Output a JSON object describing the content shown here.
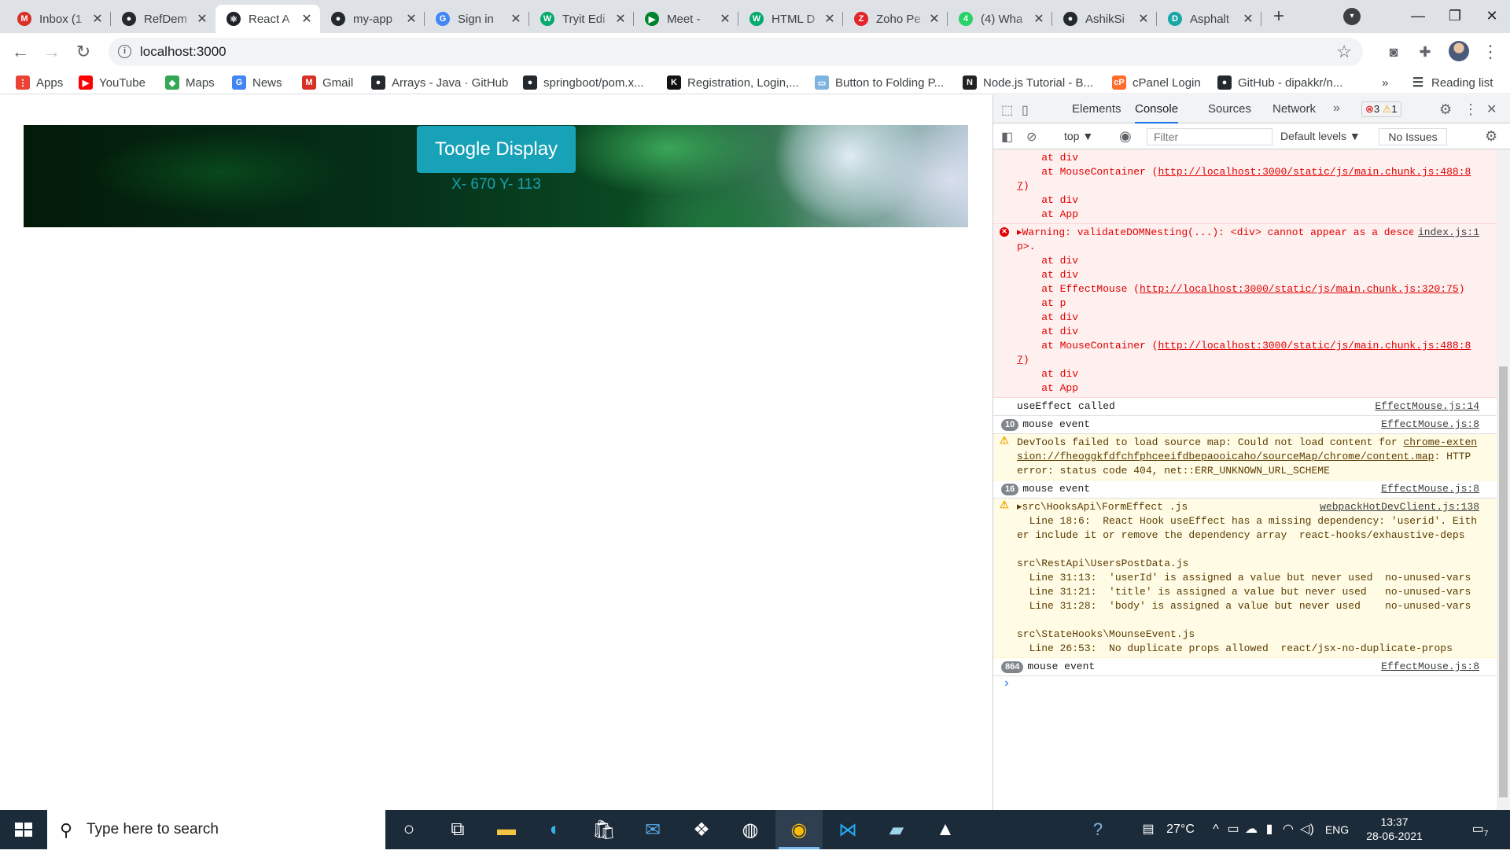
{
  "browser": {
    "tabs": [
      {
        "title": "Inbox (1",
        "icon": "gmail-icon",
        "color": "#d93025",
        "glyph": "M"
      },
      {
        "title": "RefDem",
        "icon": "github-icon",
        "color": "#24292e",
        "glyph": "●"
      },
      {
        "title": "React A",
        "icon": "react-icon",
        "color": "#20232a",
        "glyph": "⚛",
        "active": true
      },
      {
        "title": "my-app",
        "icon": "github-icon",
        "color": "#24292e",
        "glyph": "●"
      },
      {
        "title": "Sign in",
        "icon": "google-icon",
        "color": "#4285f4",
        "glyph": "G"
      },
      {
        "title": "Tryit Edi",
        "icon": "w3schools-icon",
        "color": "#04aa6d",
        "glyph": "W"
      },
      {
        "title": "Meet - ",
        "icon": "meet-icon",
        "color": "#00832d",
        "glyph": "▶"
      },
      {
        "title": "HTML D",
        "icon": "w3schools-icon",
        "color": "#04aa6d",
        "glyph": "W"
      },
      {
        "title": "Zoho Pe",
        "icon": "zoho-icon",
        "color": "#e42527",
        "glyph": "Z"
      },
      {
        "title": "(4) Wha",
        "icon": "whatsapp-icon",
        "color": "#25d366",
        "glyph": "4"
      },
      {
        "title": "AshikSi",
        "icon": "github-icon",
        "color": "#24292e",
        "glyph": "●"
      },
      {
        "title": "Asphalt",
        "icon": "asphalt-icon",
        "color": "#1aa6a6",
        "glyph": "D"
      }
    ],
    "new_tab_label": "+",
    "url": "localhost:3000"
  },
  "bookmarks": [
    {
      "label": "Apps",
      "icon": "apps-grid-icon",
      "color": "#ea4335",
      "glyph": "⋮"
    },
    {
      "label": "YouTube",
      "icon": "youtube-icon",
      "color": "#ff0000",
      "glyph": "▶"
    },
    {
      "label": "Maps",
      "icon": "maps-icon",
      "color": "#34a853",
      "glyph": "◆"
    },
    {
      "label": "News",
      "icon": "news-icon",
      "color": "#4285f4",
      "glyph": "G"
    },
    {
      "label": "Gmail",
      "icon": "gmail-icon",
      "color": "#d93025",
      "glyph": "M"
    },
    {
      "label": "Arrays - Java · GitHub",
      "icon": "github-icon",
      "color": "#24292e",
      "glyph": "●"
    },
    {
      "label": "springboot/pom.x...",
      "icon": "github-icon",
      "color": "#24292e",
      "glyph": "●"
    },
    {
      "label": "Registration, Login,...",
      "icon": "k-icon",
      "color": "#111111",
      "glyph": "K"
    },
    {
      "label": "Button to Folding P...",
      "icon": "image-icon",
      "color": "#7fb3e0",
      "glyph": "▭"
    },
    {
      "label": "Node.js Tutorial - B...",
      "icon": "nodejs-icon",
      "color": "#222222",
      "glyph": "N"
    },
    {
      "label": "cPanel Login",
      "icon": "cpanel-icon",
      "color": "#ff6c2c",
      "glyph": "cP"
    },
    {
      "label": "GitHub - dipakkr/n...",
      "icon": "github-icon",
      "color": "#24292e",
      "glyph": "●"
    }
  ],
  "reading_list": "Reading list",
  "more_bookmarks": "»",
  "app": {
    "toggle_label": "Toogle Display",
    "coords": "X- 670 Y- 113",
    "accent": "#17a2b8"
  },
  "devtools": {
    "tabs": [
      "Elements",
      "Console",
      "Sources",
      "Network"
    ],
    "active_tab": "Console",
    "errors": "3",
    "warnings": "1",
    "context": "top",
    "filter_placeholder": "Filter",
    "levels": "Default levels",
    "no_issues": "No Issues",
    "messages": [
      {
        "type": "err",
        "text": "    at div\n    at MouseContainer (",
        "link": "http://localhost:3000/static/js/main.chunk.js:488:87",
        "tail": ")\n    at div\n    at App"
      },
      {
        "type": "err",
        "icon": true,
        "source": "index.js:1",
        "text": "▸Warning: validateDOMNesting(...): <div> cannot appear as a descendant of <p>.\n    at div\n    at div\n    at EffectMouse (",
        "link": "http://localhost:3000/static/js/main.chunk.js:320:75",
        "tail": ")\n    at p\n    at div\n    at div\n    at MouseContainer (",
        "link2": "http://localhost:3000/static/js/main.chunk.js:488:87",
        "tail2": ")\n    at div\n    at App"
      },
      {
        "type": "log",
        "text": "useEffect called",
        "source": "EffectMouse.js:14"
      },
      {
        "type": "log",
        "count": "10",
        "text": "mouse event",
        "source": "EffectMouse.js:8"
      },
      {
        "type": "warn",
        "icon": true,
        "text": "DevTools failed to load source map: Could not load content for ",
        "link": "chrome-extension://fheoggkfdfchfphceeifdbepaooicaho/sourceMap/chrome/content.map",
        "tail": ": HTTP error: status code 404, net::ERR_UNKNOWN_URL_SCHEME"
      },
      {
        "type": "log",
        "count": "16",
        "text": "mouse event",
        "source": "EffectMouse.js:8"
      },
      {
        "type": "warn",
        "icon": true,
        "source": "webpackHotDevClient.js:138",
        "text": "▸src\\HooksApi\\FormEffect .js\n  Line 18:6:  React Hook useEffect has a missing dependency: 'userid'. Either include it or remove the dependency array  react-hooks/exhaustive-deps\n\nsrc\\RestApi\\UsersPostData.js\n  Line 31:13:  'userId' is assigned a value but never used  no-unused-vars\n  Line 31:21:  'title' is assigned a value but never used   no-unused-vars\n  Line 31:28:  'body' is assigned a value but never used    no-unused-vars\n\nsrc\\StateHooks\\MounseEvent.js\n  Line 26:53:  No duplicate props allowed  react/jsx-no-duplicate-props"
      },
      {
        "type": "log",
        "count": "864",
        "text": "mouse event",
        "source": "EffectMouse.js:8"
      }
    ],
    "prompt": "›"
  },
  "taskbar": {
    "search_placeholder": "Type here to search",
    "weather": "27°C",
    "lang": "ENG",
    "time": "13:37",
    "date": "28-06-2021",
    "notifications": "7"
  }
}
